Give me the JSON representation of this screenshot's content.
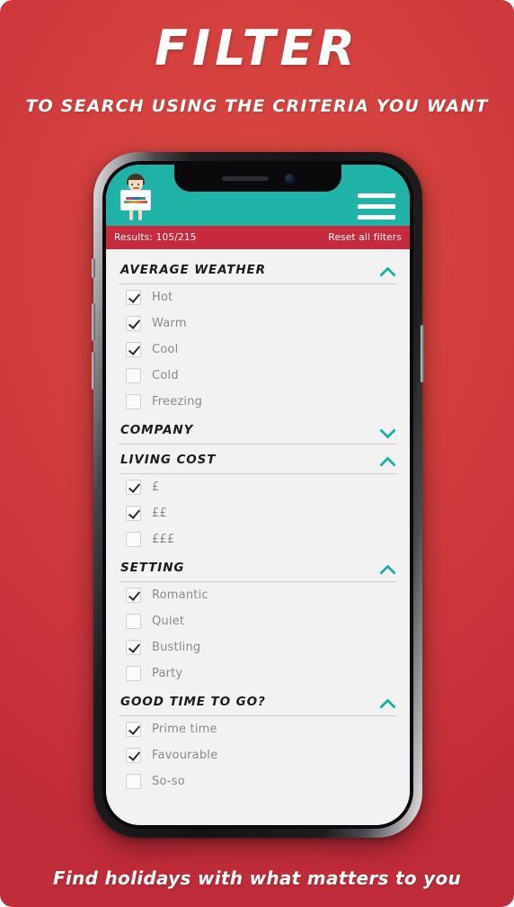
{
  "poster": {
    "title": "FILTER",
    "subtitle": "TO SEARCH USING THE CRITERIA YOU WANT",
    "tagline": "Find holidays with what matters to you",
    "background_color": "#d4403e"
  },
  "app": {
    "header": {
      "background_color": "#1fb3a8",
      "logo_alt": "My Travel Personality mascot holding sign",
      "menu_icon": "hamburger-icon"
    },
    "results_bar": {
      "background_color": "#c62a3c",
      "results_text": "Results: 105/215",
      "reset_label": "Reset all filters"
    },
    "accent_color": "#17b0a6",
    "sections": [
      {
        "title": "AVERAGE WEATHER",
        "expanded": true,
        "chevron": "chevron-up-icon",
        "options": [
          {
            "label": "Hot",
            "checked": true
          },
          {
            "label": "Warm",
            "checked": true
          },
          {
            "label": "Cool",
            "checked": true
          },
          {
            "label": "Cold",
            "checked": false
          },
          {
            "label": "Freezing",
            "checked": false
          }
        ]
      },
      {
        "title": "COMPANY",
        "expanded": false,
        "chevron": "chevron-down-icon",
        "options": []
      },
      {
        "title": "LIVING COST",
        "expanded": true,
        "chevron": "chevron-up-icon",
        "options": [
          {
            "label": "£",
            "checked": true
          },
          {
            "label": "££",
            "checked": true
          },
          {
            "label": "£££",
            "checked": false
          }
        ]
      },
      {
        "title": "SETTING",
        "expanded": true,
        "chevron": "chevron-up-icon",
        "options": [
          {
            "label": "Romantic",
            "checked": true
          },
          {
            "label": "Quiet",
            "checked": false
          },
          {
            "label": "Bustling",
            "checked": true
          },
          {
            "label": "Party",
            "checked": false
          }
        ]
      },
      {
        "title": "GOOD TIME TO GO?",
        "expanded": true,
        "chevron": "chevron-up-icon",
        "options": [
          {
            "label": "Prime time",
            "checked": true
          },
          {
            "label": "Favourable",
            "checked": true
          },
          {
            "label": "So-so",
            "checked": false
          }
        ]
      }
    ]
  }
}
